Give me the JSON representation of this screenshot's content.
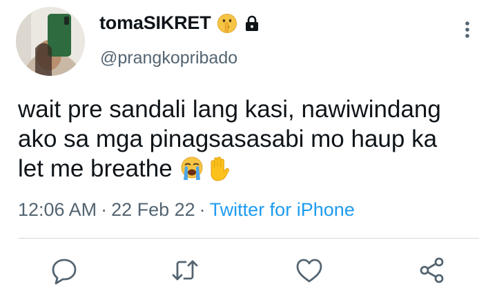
{
  "author": {
    "display_name": "tomaSIKRET",
    "handle": "@prangkopribado",
    "name_emoji": "shushing-face-emoji",
    "protected_icon": "lock-icon"
  },
  "tweet": {
    "lines": [
      "wait pre sandali lang kasi, nawiwindang",
      "ako sa mga pinagsasasabi mo haup ka",
      "let me breathe"
    ],
    "emojis": [
      "loudly-crying-face-emoji",
      "raised-hand-emoji"
    ]
  },
  "meta": {
    "time": "12:06 AM",
    "separator": "·",
    "date": "22 Feb 22",
    "source": "Twitter for iPhone"
  },
  "actions": {
    "icons": [
      "reply-icon",
      "retweet-icon",
      "like-icon",
      "share-icon"
    ]
  },
  "colors": {
    "text": "#0f1419",
    "secondary": "#536471",
    "link": "#1d9bf0",
    "divider": "#cfd9de"
  }
}
